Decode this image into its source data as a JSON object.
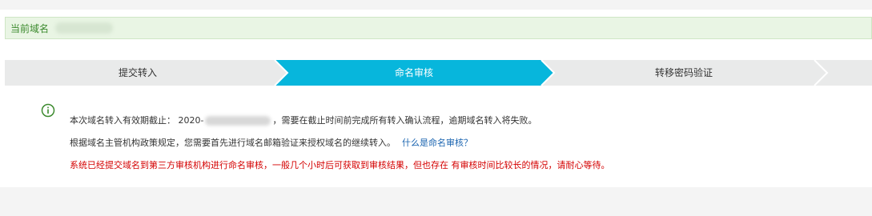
{
  "domain": {
    "label": "当前域名",
    "value_masked": true
  },
  "steps": [
    {
      "label": "提交转入",
      "state": "done"
    },
    {
      "label": "命名审核",
      "state": "active"
    },
    {
      "label": "转移密码验证",
      "state": "pending"
    },
    {
      "label": "",
      "state": "pending"
    }
  ],
  "colors": {
    "active_step": "#07b6dc",
    "inactive_step": "#e9eaea",
    "domain_bar_bg": "#e9f5e4",
    "domain_label": "#3c8a2e",
    "info_icon": "#3c8a2e",
    "link": "#1a64b0",
    "warning": "#d40000"
  },
  "notice": {
    "icon": "info-circle-icon",
    "line1_prefix": "本次域名转入有效期截止： 2020-",
    "line1_suffix": "，需要在截止时间前完成所有转入确认流程，逾期域名转入将失败。",
    "line2_text": "根据域名主管机构政策规定，您需要首先进行域名邮箱验证来授权域名的继续转入。",
    "line2_link": "什么是命名审核？",
    "line3_warning": "系统已经提交域名到第三方审核机构进行命名审核，一般几个小时后可获取到审核结果，但也存在 有审核时间比较长的情况，请耐心等待。"
  }
}
